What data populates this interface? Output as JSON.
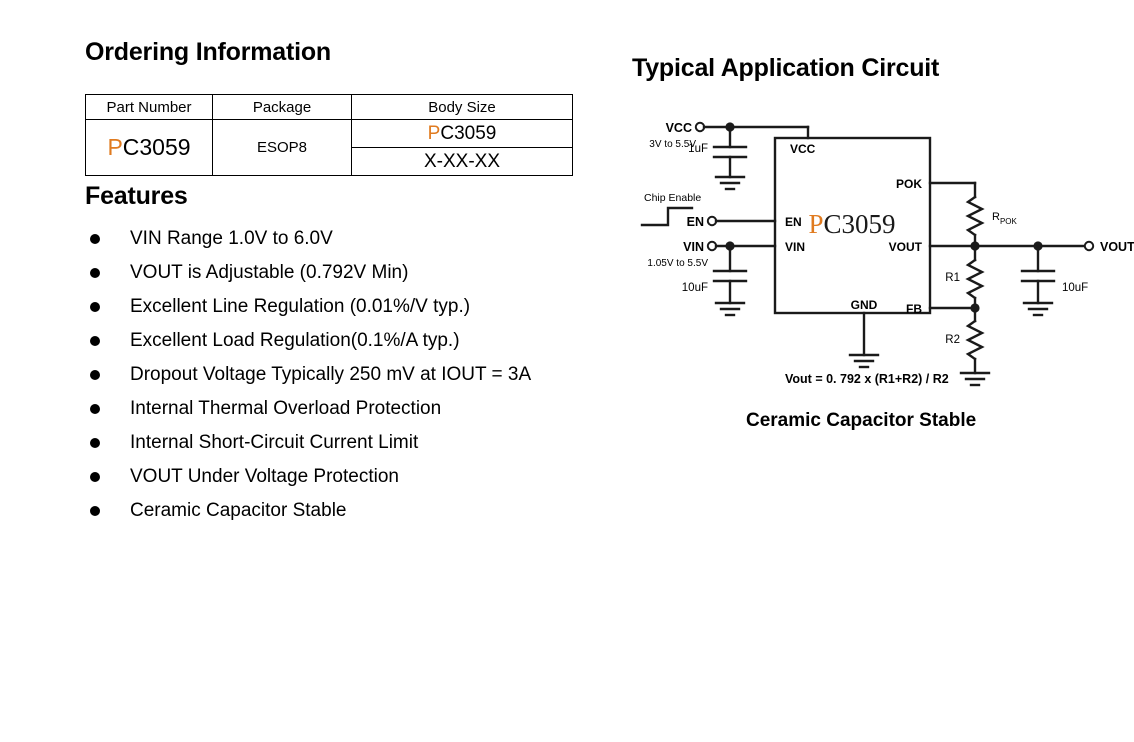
{
  "ordering": {
    "title": "Ordering Information",
    "columns": [
      "Part Number",
      "Package",
      "Body Size"
    ],
    "part_number": "PC3059",
    "part_number_accent": "P",
    "part_number_rest": "C3059",
    "package": "ESOP8",
    "body_size_line1": "PC3059",
    "body_size_line1_accent": "P",
    "body_size_line1_rest": "C3059",
    "body_size_line2": "X-XX-XX",
    "accent_color": "#e07b20"
  },
  "features": {
    "title": "Features",
    "items": [
      "VIN Range 1.0V to 6.0V",
      "VOUT is Adjustable (0.792V Min)",
      "Excellent Line Regulation (0.01%/V typ.)",
      "Excellent Load Regulation(0.1%/A typ.)",
      "Dropout Voltage Typically 250 mV at IOUT = 3A",
      "Internal Thermal Overload Protection",
      "Internal Short-Circuit Current Limit",
      "VOUT Under Voltage Protection",
      "Ceramic Capacitor Stable"
    ]
  },
  "circuit": {
    "title": "Typical Application Circuit",
    "caption": "Ceramic Capacitor Stable",
    "chip_label": "PC3059",
    "chip_label_accent": "P",
    "chip_label_rest": "C3059",
    "pins": {
      "vcc": "VCC",
      "en": "EN",
      "vin": "VIN",
      "gnd": "GND",
      "pok": "POK",
      "vout": "VOUT",
      "fb": "FB"
    },
    "terminals": {
      "vcc_label": "VCC",
      "vcc_range": "3V to 5.5V",
      "chip_enable_label": "Chip Enable",
      "en_label": "EN",
      "vin_label": "VIN",
      "vin_range": "1.05V to 5.5V",
      "vout_label": "VOUT"
    },
    "components": {
      "c_in_vcc": "1uF",
      "c_in_vin": "10uF",
      "c_out": "10uF",
      "r_pok": "R",
      "r_pok_sub": "POK",
      "r1": "R1",
      "r2": "R2"
    },
    "formula": "Vout = 0. 792 x (R1+R2) / R2"
  }
}
